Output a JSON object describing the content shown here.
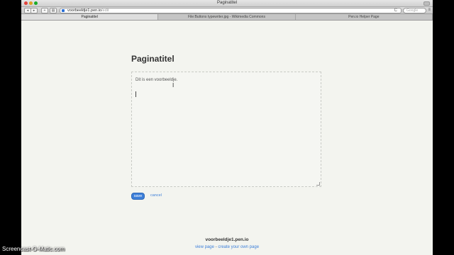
{
  "window": {
    "title": "Paginatitel"
  },
  "toolbar": {
    "back": "◂",
    "forward": "▸",
    "add": "+",
    "bookmarks": "▤",
    "url_main": "voorbeeldje1.pen.io",
    "url_path": "/edit",
    "reload": "C",
    "search_placeholder": "Google",
    "menu": "≡"
  },
  "tabs": [
    {
      "label": "Paginatitel",
      "active": true
    },
    {
      "label": "File:Buttons typewriter.jpg - Wikimedia Commons",
      "active": false
    },
    {
      "label": "Pen.io Helper Page",
      "active": false
    }
  ],
  "page": {
    "title": "Paginatitel",
    "editor_text": "Dit is een voorbeeldje.",
    "save_label": "save",
    "cancel_label": "cancel"
  },
  "footer": {
    "domain": "voorbeeldje1.pen.io",
    "view_page": "view page",
    "separator": " - ",
    "create_own": "create your own page"
  },
  "watermark": "Screencast-O-Matic.com",
  "colors": {
    "accent": "#3d7fd9",
    "page_bg": "#f3f4ef"
  }
}
